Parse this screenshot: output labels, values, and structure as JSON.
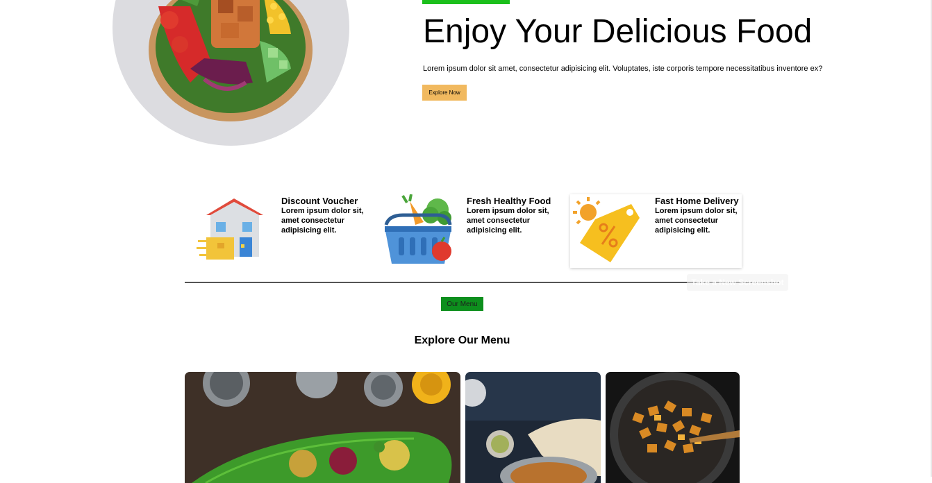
{
  "hero": {
    "title": "Enjoy Your Delicious Food",
    "description": "Lorem ipsum dolor sit amet, consectetur adipisicing elit. Voluptates, iste corporis tempore necessitatibus inventore ex?",
    "cta_label": "Explore Now"
  },
  "features": [
    {
      "icon": "house-delivery-icon",
      "title": "Discount Voucher",
      "description": "Lorem ipsum dolor sit, amet consectetur adipisicing elit."
    },
    {
      "icon": "vegetable-basket-icon",
      "title": "Fresh Healthy Food",
      "description": "Lorem ipsum dolor sit, amet consectetur adipisicing elit."
    },
    {
      "icon": "discount-tag-icon",
      "title": "Fast Home Delivery",
      "description": "Lorem ipsum dolor sit, amet consectetur adipisicing elit."
    }
  ],
  "overlay": {
    "label": "Take a New Screenshot"
  },
  "menu": {
    "tag_label": "Our Menu",
    "heading": "Explore Our Menu"
  },
  "colors": {
    "accent_green": "#1bbf1b",
    "button_orange": "#f1b95f",
    "menu_tag_green": "#0d8f1d"
  }
}
